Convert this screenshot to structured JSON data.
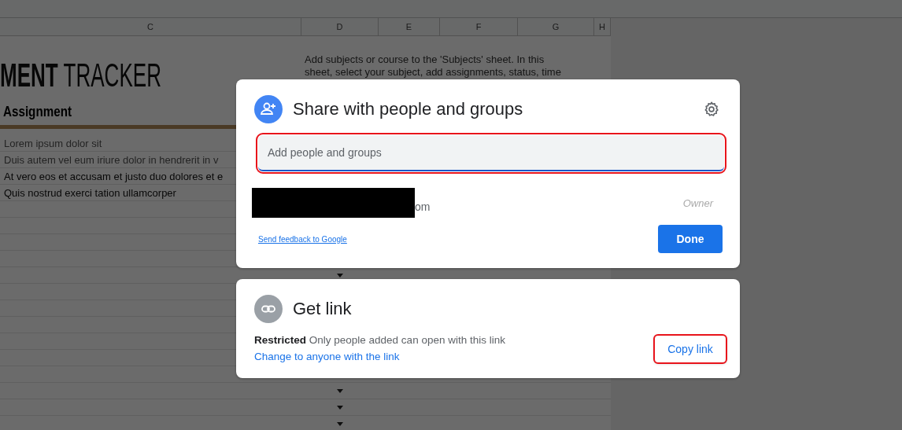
{
  "sheet": {
    "columns": [
      "C",
      "D",
      "E",
      "F",
      "G",
      "H"
    ],
    "title": "**MENT** TRACKER",
    "note_lines": [
      "Add subjects or course to the 'Subjects' sheet. In this",
      "sheet, select your subject, add assignments, status, time"
    ],
    "header": "Assignment",
    "rows": [
      {
        "text": "Lorem ipsum dolor sit",
        "muted": true
      },
      {
        "text": "Duis autem vel eum iriure dolor in hendrerit in v",
        "muted": true
      },
      {
        "text": "At vero eos et accusam et justo duo dolores et e",
        "muted": false
      },
      {
        "text": "Quis nostrud exerci tation ullamcorper",
        "muted": false
      },
      {},
      {},
      {},
      {},
      {
        "dropdown": true
      },
      {},
      {},
      {},
      {},
      {},
      {},
      {
        "dropdown": true
      },
      {
        "dropdown": true
      },
      {
        "dropdown": true
      }
    ]
  },
  "share_dialog": {
    "title": "Share with people and groups",
    "input": {
      "placeholder": "Add people and groups",
      "highlighted": true
    },
    "owner": {
      "email_tail": "om",
      "role": "Owner"
    },
    "feedback_link": "Send feedback to Google",
    "done_button": "Done"
  },
  "link_dialog": {
    "title": "Get link",
    "access": "**Restricted** Only people added can open with this link",
    "change_link": "Change to anyone with the link",
    "copy_button": {
      "label": "Copy link",
      "highlighted": true
    }
  }
}
